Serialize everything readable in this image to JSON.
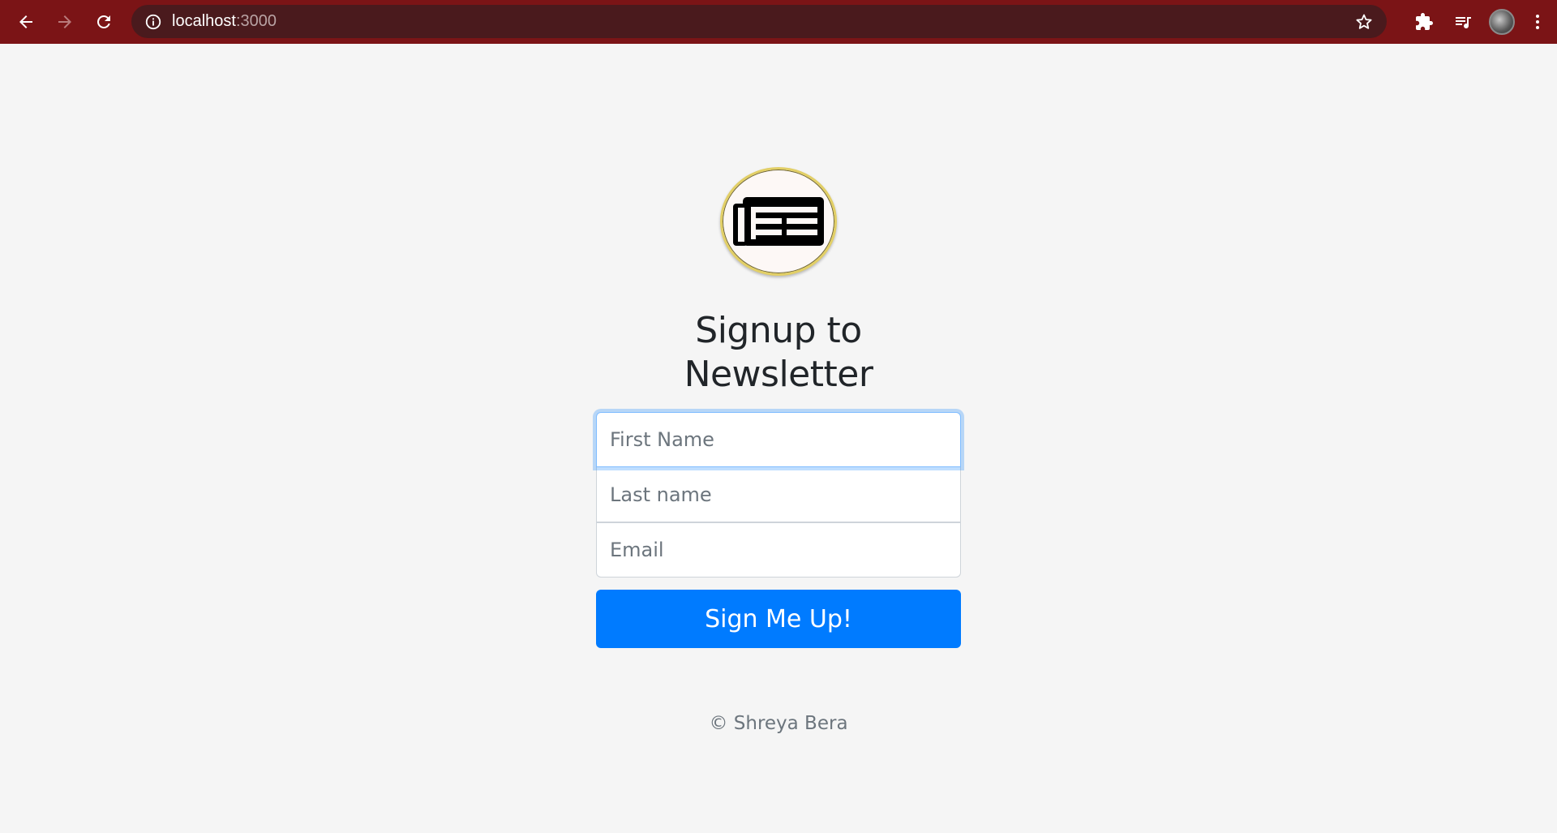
{
  "browser": {
    "url_host": "localhost",
    "url_port": ":3000",
    "chrome_color": "#7b1416",
    "omnibox_color": "#4a1a1d"
  },
  "page": {
    "heading": "Signup to Newsletter",
    "logo_icon": "newspaper-icon",
    "form": {
      "first_name_placeholder": "First Name",
      "last_name_placeholder": "Last name",
      "email_placeholder": "Email",
      "submit_label": "Sign Me Up!"
    },
    "footer": "© Shreya Bera",
    "accent_color": "#007bff"
  }
}
